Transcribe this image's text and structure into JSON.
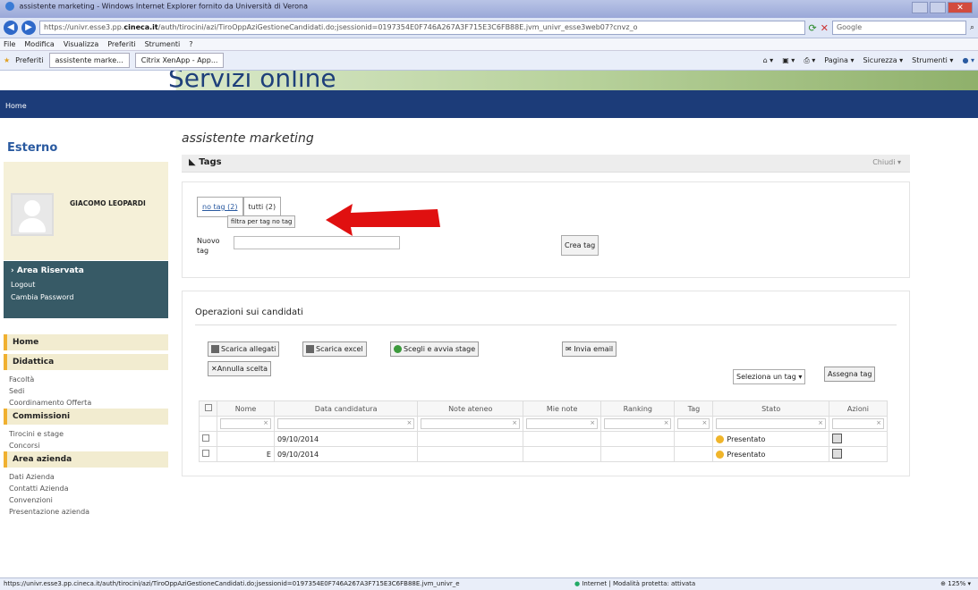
{
  "browser": {
    "title": "assistente marketing - Windows Internet Explorer fornito da Università di Verona",
    "url_prefix": "https://univr.esse3.pp.",
    "url_domain": "cineca.it",
    "url_rest": "/auth/tirocini/azi/TiroOppAziGestioneCandidati.do;jsessionid=0197354E0F746A267A3F715E3C6FB88E.jvm_univr_esse3web07?cnvz_o",
    "search_label": "Google",
    "menu": [
      "File",
      "Modifica",
      "Visualizza",
      "Preferiti",
      "Strumenti",
      "?"
    ],
    "favorites": "Preferiti",
    "tabs": [
      "assistente marke...",
      "Citrix XenApp - App..."
    ],
    "cmd": [
      "Pagina ▾",
      "Sicurezza ▾",
      "Strumenti ▾"
    ],
    "status_url": "https://univr.esse3.pp.cineca.it/auth/tirocini/azi/TiroOppAziGestioneCandidati.do;jsessionid=0197354E0F746A267A3F715E3C6FB88E.jvm_univr_e",
    "status_zone": "Internet | Modalità protetta: attivata",
    "zoom": "125%"
  },
  "site": {
    "banner_title": "Servizi online",
    "nav_home": "Home"
  },
  "sidebar": {
    "esterno": "Esterno",
    "user_name": "GIACOMO LEOPARDI",
    "area_riservata": "Area Riservata",
    "logout": "Logout",
    "cambia_password": "Cambia Password",
    "home": "Home",
    "didattica": "Didattica",
    "didattica_items": [
      "Facoltà",
      "Sedi",
      "Coordinamento Offerta"
    ],
    "commissioni": "Commissioni",
    "commissioni_items": [
      "Tirocini e stage",
      "Concorsi"
    ],
    "area_azienda": "Area azienda",
    "azienda_items": [
      "Dati Azienda",
      "Contatti Azienda",
      "Convenzioni",
      "Presentazione azienda"
    ]
  },
  "main": {
    "title": "assistente marketing",
    "tags_header": "Tags",
    "chiudi": "Chiudi",
    "tag_no": "no tag (2)",
    "tag_tutti": "tutti (2)",
    "tooltip": "filtra per tag no tag",
    "nuovo_tag": "Nuovo tag",
    "crea_tag": "Crea tag",
    "operazioni": "Operazioni sui candidati",
    "scarica_allegati": "Scarica allegati",
    "scarica_excel": "Scarica excel",
    "scegli": "Scegli e avvia stage",
    "invia": "Invia email",
    "annulla": "Annulla scelta",
    "seleziona_tag": "Seleziona un tag",
    "assegna_tag": "Assegna tag",
    "columns": [
      "Nome",
      "Data candidatura",
      "Note ateneo",
      "Mie note",
      "Ranking",
      "Tag",
      "Stato",
      "Azioni"
    ],
    "rows": [
      {
        "nome": "",
        "data": "09/10/2014",
        "stato": "Presentato"
      },
      {
        "nome": "E",
        "data": "09/10/2014",
        "stato": "Presentato"
      }
    ]
  }
}
